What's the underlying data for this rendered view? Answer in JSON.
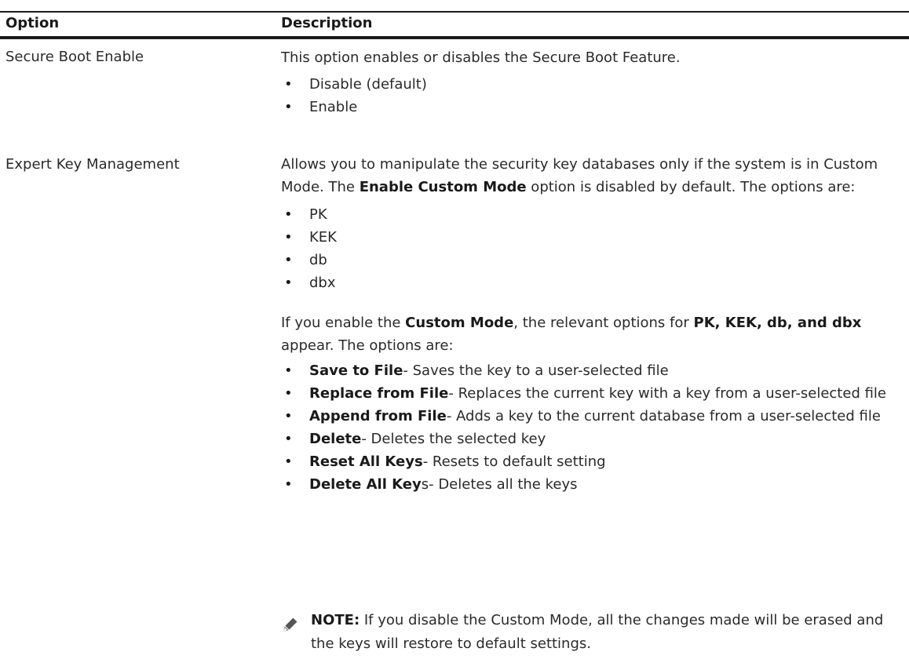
{
  "table": {
    "header": {
      "option": "Option",
      "description": "Description"
    },
    "rows": [
      {
        "option": "Secure Boot Enable",
        "description": "This option enables or disables the Secure Boot Feature.",
        "items": [
          "Disable (default)",
          "Enable"
        ]
      },
      {
        "option": "Expert Key Management",
        "description_part1": "Allows you to manipulate the security key databases only if the system is in Custom Mode. The ",
        "description_bold": "Enable Custom Mode",
        "description_part2": " option is disabled by default. The options are:",
        "items": [
          "PK",
          "KEK",
          "db",
          "dbx"
        ],
        "custom_text_1": "If you enable the ",
        "custom_bold_1": "Custom Mode",
        "custom_text_2": ", the relevant options for ",
        "custom_bold_2": "PK, KEK, db, and dbx",
        "custom_text_3": " appear. The options are:",
        "actions": [
          {
            "name": "Save to File",
            "desc": "- Saves the key to a user-selected file"
          },
          {
            "name": "Replace from File",
            "desc": "- Replaces the current key with a key from a user-selected file"
          },
          {
            "name": "Append from File",
            "desc": "- Adds a key to the current database from a user-selected file"
          },
          {
            "name": "Delete",
            "desc": "- Deletes the selected key"
          },
          {
            "name": "Reset All Keys",
            "desc": "- Resets to default setting"
          },
          {
            "name": "Delete All Key",
            "name_suffix": "s",
            "desc": "- Deletes all the keys"
          }
        ],
        "note_label": "NOTE:",
        "note_text": " If you disable the Custom Mode, all the changes made will be erased and the keys will restore to default settings."
      }
    ]
  },
  "icons": {
    "note": "pencil-note-icon"
  }
}
